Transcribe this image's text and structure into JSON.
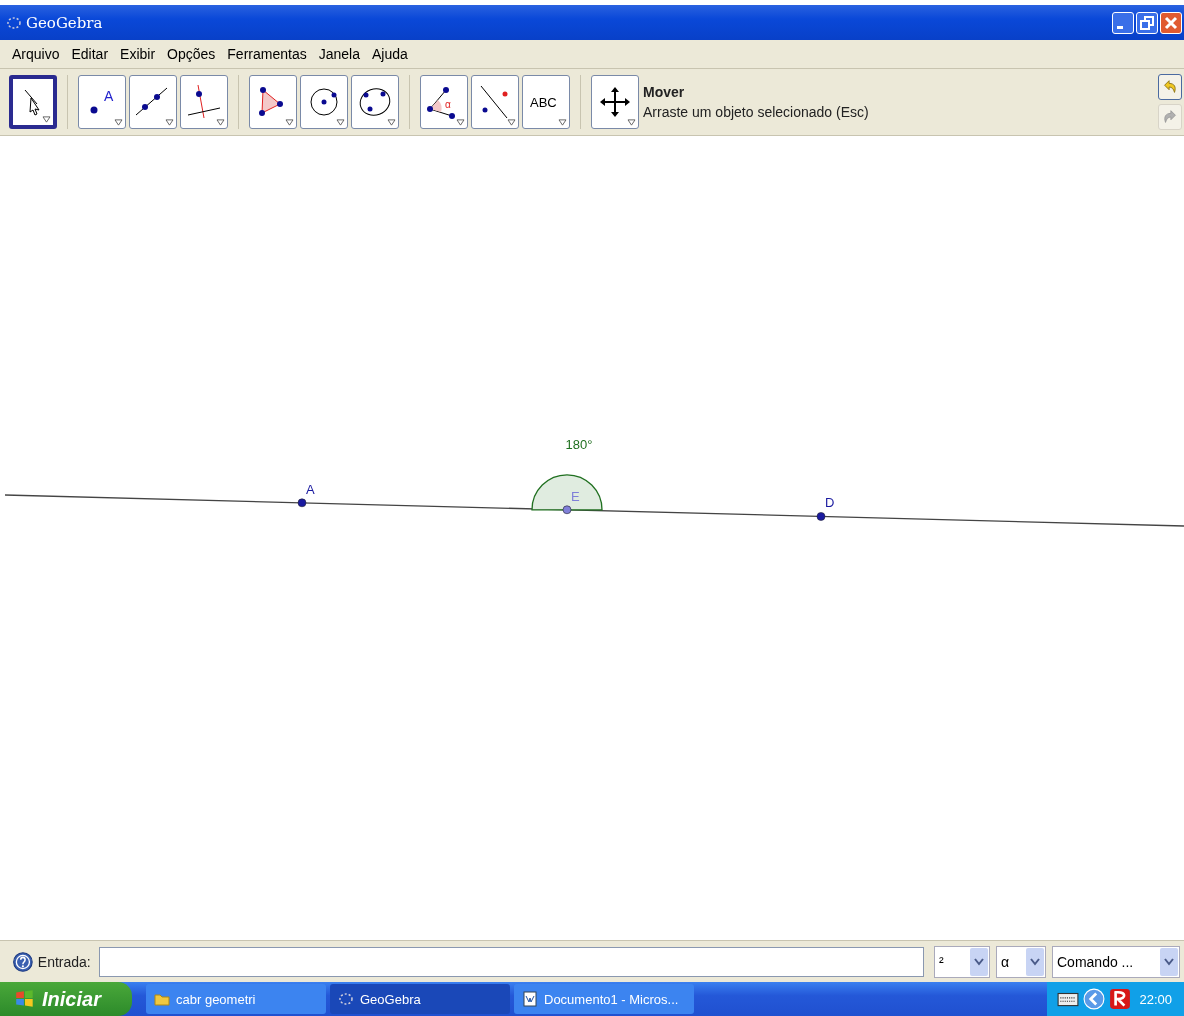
{
  "window": {
    "title": "GeoGebra"
  },
  "menu": [
    "Arquivo",
    "Editar",
    "Exibir",
    "Opções",
    "Ferramentas",
    "Janela",
    "Ajuda"
  ],
  "toolbar": {
    "groups": [
      [
        {
          "kind": "move",
          "selected": true
        }
      ],
      [
        {
          "kind": "point",
          "label": "A",
          "selected": false
        },
        {
          "kind": "line",
          "selected": false
        },
        {
          "kind": "perpendicular",
          "selected": false
        }
      ],
      [
        {
          "kind": "polygon",
          "selected": false
        },
        {
          "kind": "circle",
          "selected": false
        },
        {
          "kind": "conic",
          "selected": false
        }
      ],
      [
        {
          "kind": "angle",
          "label": "α",
          "selected": false
        },
        {
          "kind": "reflect",
          "selected": false
        },
        {
          "kind": "text",
          "label": "ABC",
          "selected": false
        }
      ],
      [
        {
          "kind": "move_view",
          "selected": false
        }
      ]
    ],
    "tool_name": "Mover",
    "tool_help": "Arraste um objeto selecionado (Esc)",
    "undo": {
      "disabled": false
    },
    "redo": {
      "disabled": true
    }
  },
  "canvas": {
    "points": [
      {
        "label": "A",
        "color": "#1a1aa0"
      },
      {
        "label": "E",
        "color": "#8080d8"
      },
      {
        "label": "D",
        "color": "#1a1aa0"
      }
    ],
    "angle": {
      "label": "180°"
    }
  },
  "input_bar": {
    "label": "Entrada:",
    "dropdowns": [
      "²",
      "α",
      "Comando ..."
    ]
  },
  "taskbar": {
    "start": "Iniciar",
    "tasks": [
      {
        "label": "cabr geometri",
        "kind": "folder",
        "selected": false
      },
      {
        "label": "GeoGebra",
        "kind": "geogebra",
        "selected": true
      },
      {
        "label": "Documento1 - Micros...",
        "kind": "document",
        "selected": false
      }
    ],
    "clock": "22:00"
  }
}
